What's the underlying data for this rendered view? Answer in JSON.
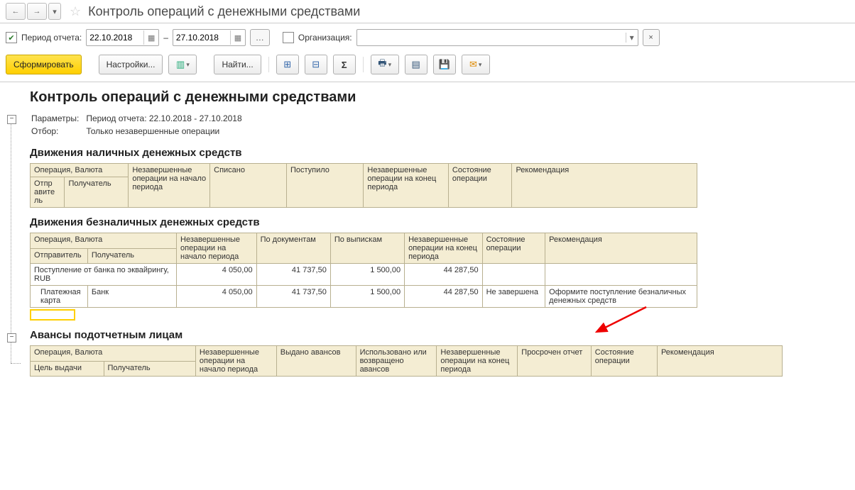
{
  "header": {
    "title": "Контроль операций с денежными средствами"
  },
  "filter": {
    "period_label": "Период отчета:",
    "date_from": "22.10.2018",
    "date_to": "27.10.2018",
    "dash": "–",
    "org_label": "Организация:",
    "org_value": ""
  },
  "toolbar": {
    "generate": "Сформировать",
    "settings": "Настройки...",
    "find": "Найти..."
  },
  "report": {
    "title": "Контроль операций с денежными средствами",
    "params_label": "Параметры:",
    "params_value": "Период отчета: 22.10.2018 - 27.10.2018",
    "filter_label": "Отбор:",
    "filter_value": "Только незавершенные операции"
  },
  "cash": {
    "title": "Движения наличных денежных средств",
    "h_operation": "Операция, Валюта",
    "h_sender": "Отпр авите ль",
    "h_receiver": "Получатель",
    "h_unfinished_start": "Незавершенные операции на начало периода",
    "h_written": "Списано",
    "h_received": "Поступило",
    "h_unfinished_end": "Незавершенные операции на конец периода",
    "h_state": "Состояние операции",
    "h_recommend": "Рекомендация"
  },
  "noncash": {
    "title": "Движения безналичных денежных средств",
    "h_operation": "Операция, Валюта",
    "h_sender": "Отправитель",
    "h_receiver": "Получатель",
    "h_unfinished_start": "Незавершенные операции на начало периода",
    "h_docs": "По документам",
    "h_statements": "По выпискам",
    "h_unfinished_end": "Незавершенные операции на конец периода",
    "h_state": "Состояние операции",
    "h_recommend": "Рекомендация",
    "row1": {
      "op": "Поступление от банка по эквайрингу, RUB",
      "start": "4 050,00",
      "docs": "41 737,50",
      "stmts": "1 500,00",
      "end": "44 287,50",
      "state": "",
      "rec": ""
    },
    "row2": {
      "sender": "Платежная карта",
      "receiver": "Банк",
      "start": "4 050,00",
      "docs": "41 737,50",
      "stmts": "1 500,00",
      "end": "44 287,50",
      "state": "Не завершена",
      "rec": "Оформите поступление безналичных денежных средств"
    }
  },
  "advances": {
    "title": "Авансы подотчетным лицам",
    "h_operation": "Операция, Валюта",
    "h_purpose": "Цель выдачи",
    "h_receiver": "Получатель",
    "h_unfinished_start": "Незавершенные операции на начало периода",
    "h_issued": "Выдано авансов",
    "h_used": "Использовано или возвращено авансов",
    "h_unfinished_end": "Незавершенные операции на конец периода",
    "h_overdue": "Просрочен отчет",
    "h_state": "Состояние операции",
    "h_recommend": "Рекомендация"
  }
}
